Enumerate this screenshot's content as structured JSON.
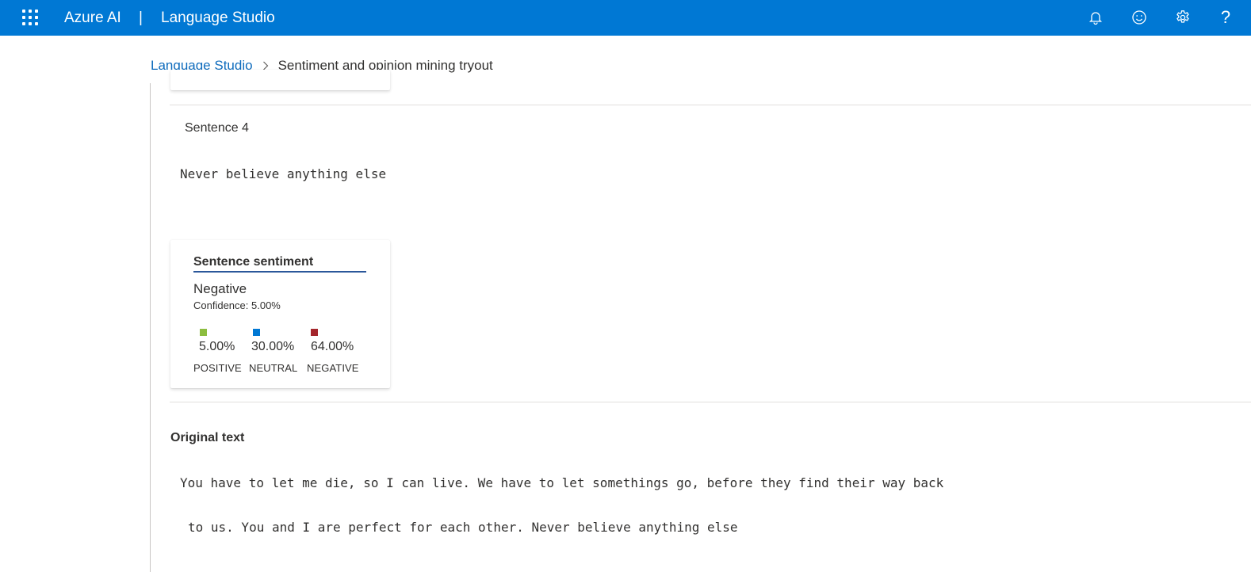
{
  "header": {
    "brand": "Azure AI",
    "separator": "|",
    "app_title": "Language Studio",
    "icons": [
      "waffle-icon",
      "bell-icon",
      "smiley-icon",
      "gear-icon",
      "help-icon"
    ],
    "help_glyph": "?"
  },
  "breadcrumb": {
    "root": "Language Studio",
    "current": "Sentiment and opinion mining tryout"
  },
  "sentence": {
    "label": "Sentence 4",
    "text": "Never believe anything else"
  },
  "sentiment_card": {
    "title": "Sentence sentiment",
    "label": "Negative",
    "confidence": "Confidence: 5.00%",
    "scores": [
      {
        "percent": "5.00%",
        "caption": "POSITIVE",
        "color": "#8cbd3f"
      },
      {
        "percent": "30.00%",
        "caption": "NEUTRAL",
        "color": "#0078d4"
      },
      {
        "percent": "64.00%",
        "caption": "NEGATIVE",
        "color": "#a4262c"
      }
    ]
  },
  "original": {
    "title": "Original text",
    "line1": "You have to let me die, so I can live. We have to let somethings go, before they find their way back",
    "line2": "to us. You and I are perfect for each other. Never believe anything else"
  },
  "colors": {
    "accent": "#0078d4",
    "link": "#0f6cbd"
  }
}
